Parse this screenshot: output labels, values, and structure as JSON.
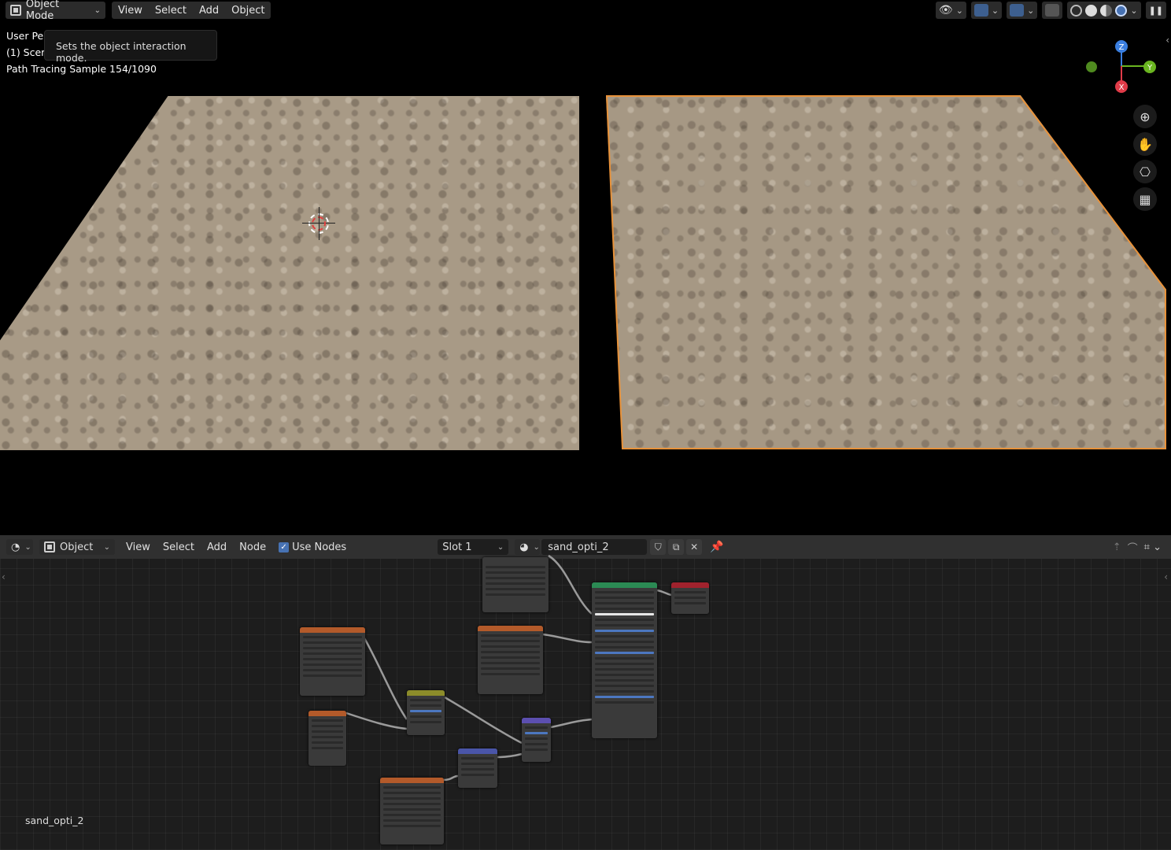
{
  "viewport": {
    "header": {
      "mode": "Object Mode",
      "menus": [
        "View",
        "Select",
        "Add",
        "Object"
      ]
    },
    "overlay": {
      "line1": "User Per",
      "line2": "(1) Scer",
      "sample": "Path Tracing Sample 154/1090"
    },
    "tooltip": "Sets the object interaction mode.",
    "gizmo": {
      "z": "Z",
      "y": "Y",
      "x": "X"
    }
  },
  "node_editor": {
    "header": {
      "type": "Object",
      "menus": [
        "View",
        "Select",
        "Add",
        "Node"
      ],
      "use_nodes_label": "Use Nodes",
      "use_nodes_checked": true,
      "slot": "Slot 1",
      "material_name": "sand_opti_2"
    },
    "footer_name": "sand_opti_2"
  },
  "colors": {
    "selection_outline": "#e8923a",
    "accent_blue": "#4772b3",
    "header_bg": "#303030"
  }
}
